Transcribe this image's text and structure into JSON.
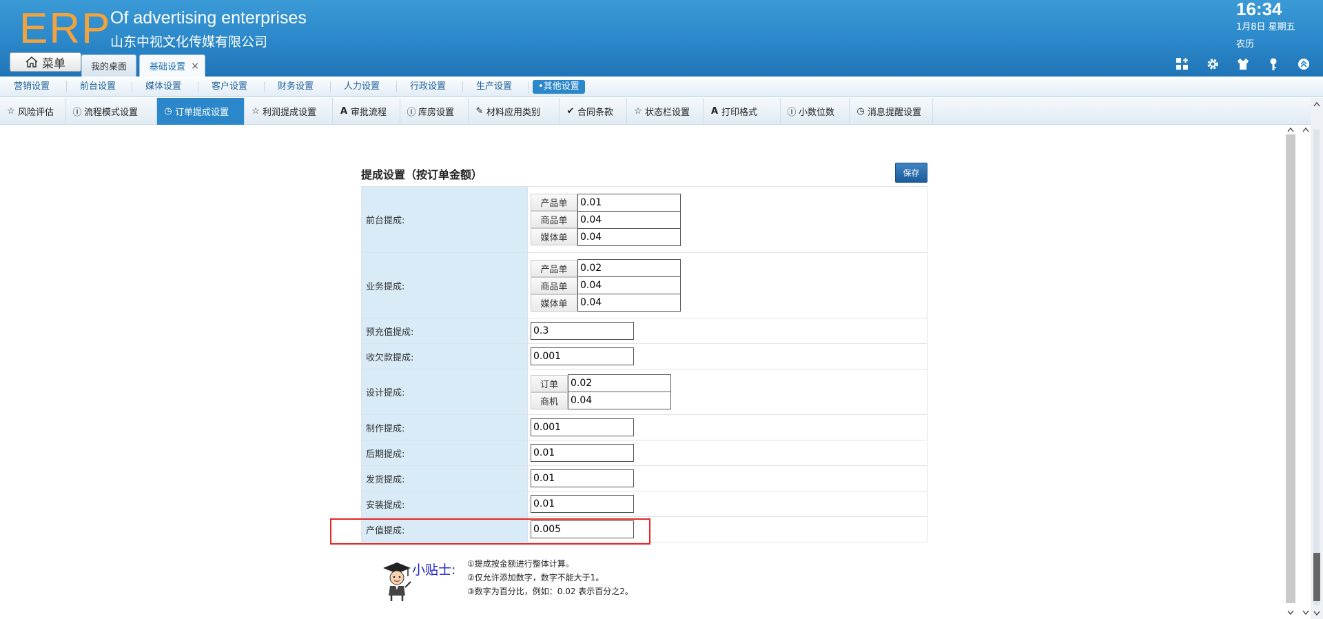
{
  "header": {
    "logo": "ERP",
    "brand_en": "Of advertising enterprises",
    "brand_cn": "山东中视文化传媒有限公司",
    "time": "16:34",
    "date": "1月8日 星期五",
    "lunar": "农历",
    "menu_label": "菜单",
    "tabs": [
      {
        "label": "我的桌面"
      },
      {
        "label": "基础设置",
        "close": "×"
      }
    ],
    "icons": [
      "grid-add-icon",
      "gear-icon",
      "shirt-icon",
      "key-icon",
      "collapse-icon"
    ]
  },
  "nav1": {
    "items": [
      "营销设置",
      "前台设置",
      "媒体设置",
      "客户设置",
      "财务设置",
      "人力设置",
      "行政设置",
      "生产设置",
      "•其他设置"
    ],
    "active_index": 8
  },
  "nav2": {
    "items": [
      {
        "icon": "star-icon",
        "label": "风险评估"
      },
      {
        "icon": "circle-pause-icon",
        "label": "流程模式设置"
      },
      {
        "icon": "clock-icon",
        "label": "订单提成设置"
      },
      {
        "icon": "star-icon",
        "label": "利润提成设置"
      },
      {
        "icon": "font-icon",
        "label": "审批流程"
      },
      {
        "icon": "circle-pause-icon",
        "label": "库房设置"
      },
      {
        "icon": "pencil-icon",
        "label": "材料应用类别"
      },
      {
        "icon": "check-icon",
        "label": "合同条款"
      },
      {
        "icon": "star-icon",
        "label": "状态栏设置"
      },
      {
        "icon": "font-icon",
        "label": "打印格式"
      },
      {
        "icon": "circle-pause-icon",
        "label": "小数位数"
      },
      {
        "icon": "clock-icon",
        "label": "消息提醒设置"
      }
    ],
    "active_index": 2
  },
  "form": {
    "title": "提成设置（按订单金额）",
    "save_label": "保存",
    "rows": [
      {
        "label": "前台提成:",
        "subs": [
          {
            "tag": "产品单",
            "value": "0.01"
          },
          {
            "tag": "商品单",
            "value": "0.04"
          },
          {
            "tag": "媒体单",
            "value": "0.04"
          }
        ]
      },
      {
        "label": "业务提成:",
        "subs": [
          {
            "tag": "产品单",
            "value": "0.02"
          },
          {
            "tag": "商品单",
            "value": "0.04"
          },
          {
            "tag": "媒体单",
            "value": "0.04"
          }
        ]
      },
      {
        "label": "预充值提成:",
        "value": "0.3"
      },
      {
        "label": "收欠款提成:",
        "value": "0.001"
      },
      {
        "label": "设计提成:",
        "subs": [
          {
            "tag": "订单",
            "value": "0.02"
          },
          {
            "tag": "商机",
            "value": "0.04"
          }
        ]
      },
      {
        "label": "制作提成:",
        "value": "0.001"
      },
      {
        "label": "后期提成:",
        "value": "0.01"
      },
      {
        "label": "发货提成:",
        "value": "0.01"
      },
      {
        "label": "安装提成:",
        "value": "0.01"
      },
      {
        "label": "产值提成:",
        "value": "0.005"
      }
    ]
  },
  "tips": {
    "label": "小贴士:",
    "lines": [
      "①提成按金额进行整体计算。",
      "②仅允许添加数字，数字不能大于1。",
      "③数字为百分比，例如：0.02 表示百分之2。"
    ]
  },
  "colors": {
    "header": "#2b87c9",
    "logo": "#f4a33c",
    "label_bg": "#d9ebf7",
    "highlight": "#e52424"
  }
}
